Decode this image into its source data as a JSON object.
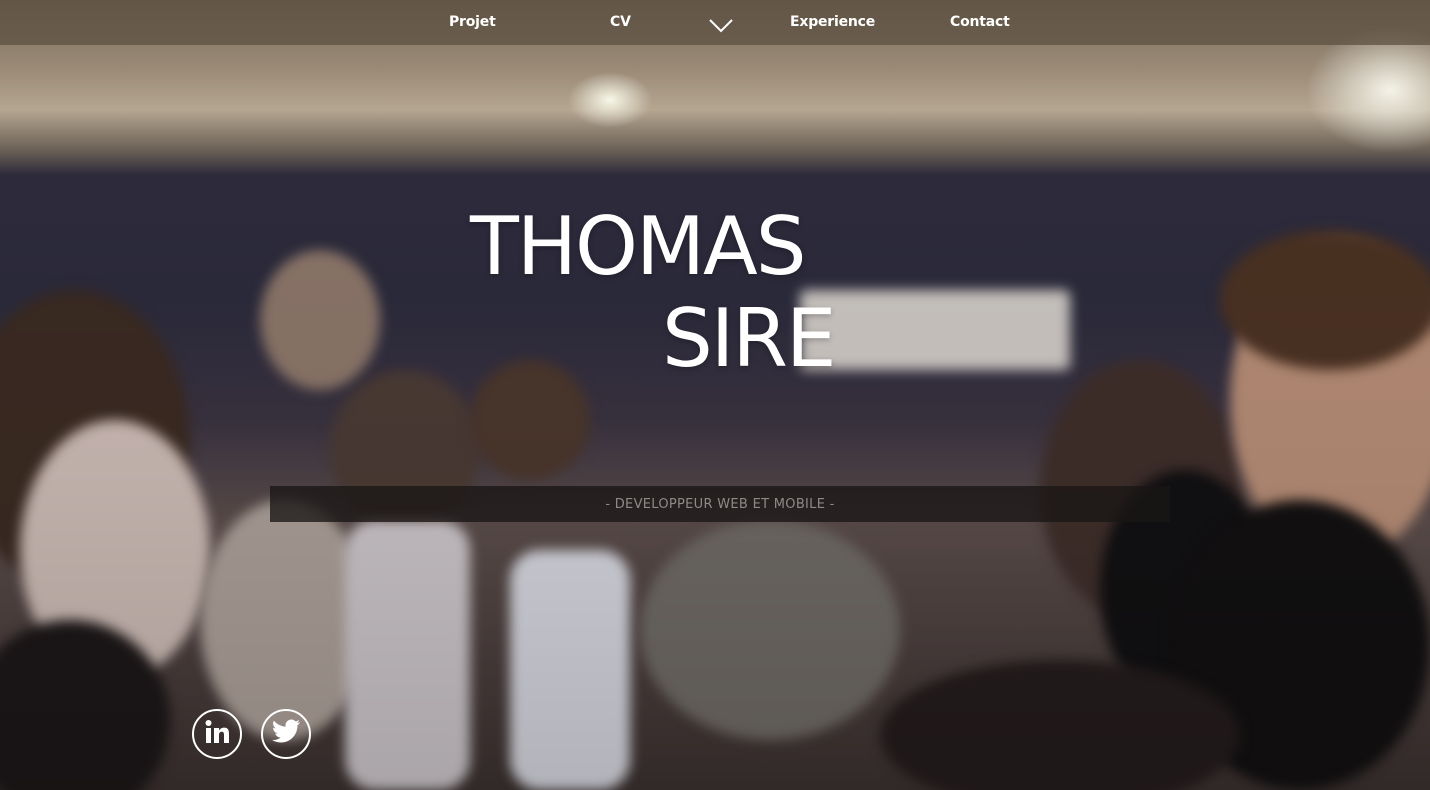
{
  "nav": {
    "items": [
      {
        "label": "Projet"
      },
      {
        "label": "CV"
      },
      {
        "label": "Experience"
      },
      {
        "label": "Contact"
      }
    ],
    "chevron_icon": "chevron-down-icon"
  },
  "hero": {
    "first_name": "THOMAS",
    "last_name": "SIRE",
    "tagline": "- DEVELOPPEUR WEB ET MOBILE -"
  },
  "social": [
    {
      "icon": "linkedin-icon"
    },
    {
      "icon": "twitter-icon"
    }
  ],
  "colors": {
    "nav_bg": "#5a4e3e",
    "text": "#ffffff",
    "tagline_bg": "#191616",
    "tagline_text": "#8e8a86"
  }
}
